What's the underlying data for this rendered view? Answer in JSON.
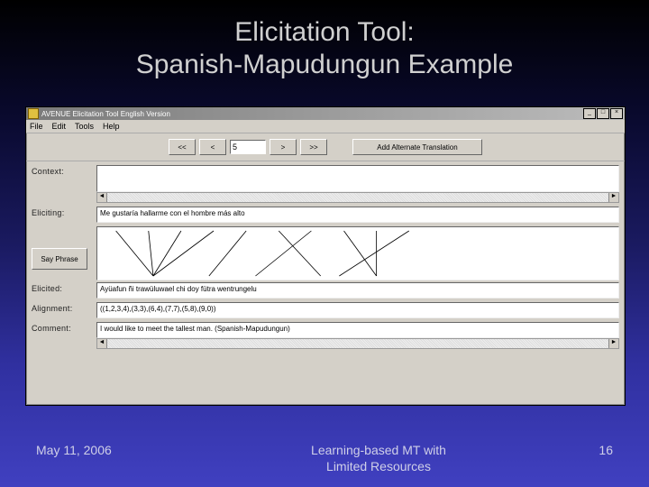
{
  "slide": {
    "title_line1": "Elicitation Tool:",
    "title_line2": "Spanish-Mapudungun Example",
    "footer_date": "May 11, 2006",
    "footer_mid_line1": "Learning-based MT with",
    "footer_mid_line2": "Limited Resources",
    "footer_page": "16"
  },
  "app": {
    "window_title": "AVENUE Elicitation Tool English Version",
    "menu": {
      "file": "File",
      "edit": "Edit",
      "tools": "Tools",
      "help": "Help"
    },
    "toolbar": {
      "first": "<<",
      "prev": "<",
      "index": "5",
      "next": ">",
      "last": ">>",
      "add_alt": "Add Alternate Translation"
    },
    "labels": {
      "context": "Context:",
      "eliciting": "Eliciting:",
      "elicited": "Elicited:",
      "alignment": "Alignment:",
      "comment": "Comment:",
      "say_phrase": "Say Phrase"
    },
    "fields": {
      "context": "",
      "eliciting": "Me gustaría hallarme con el hombre más alto",
      "elicited": "Ayüafun ñi trawüluwael chi doy fütra wentrungelu",
      "alignment": "((1,2,3,4),(3,3),(6,4),(7,7),(5,8),(9,0))",
      "comment": "I would like to meet the tallest man. (Spanish-Mapudungun)"
    }
  }
}
